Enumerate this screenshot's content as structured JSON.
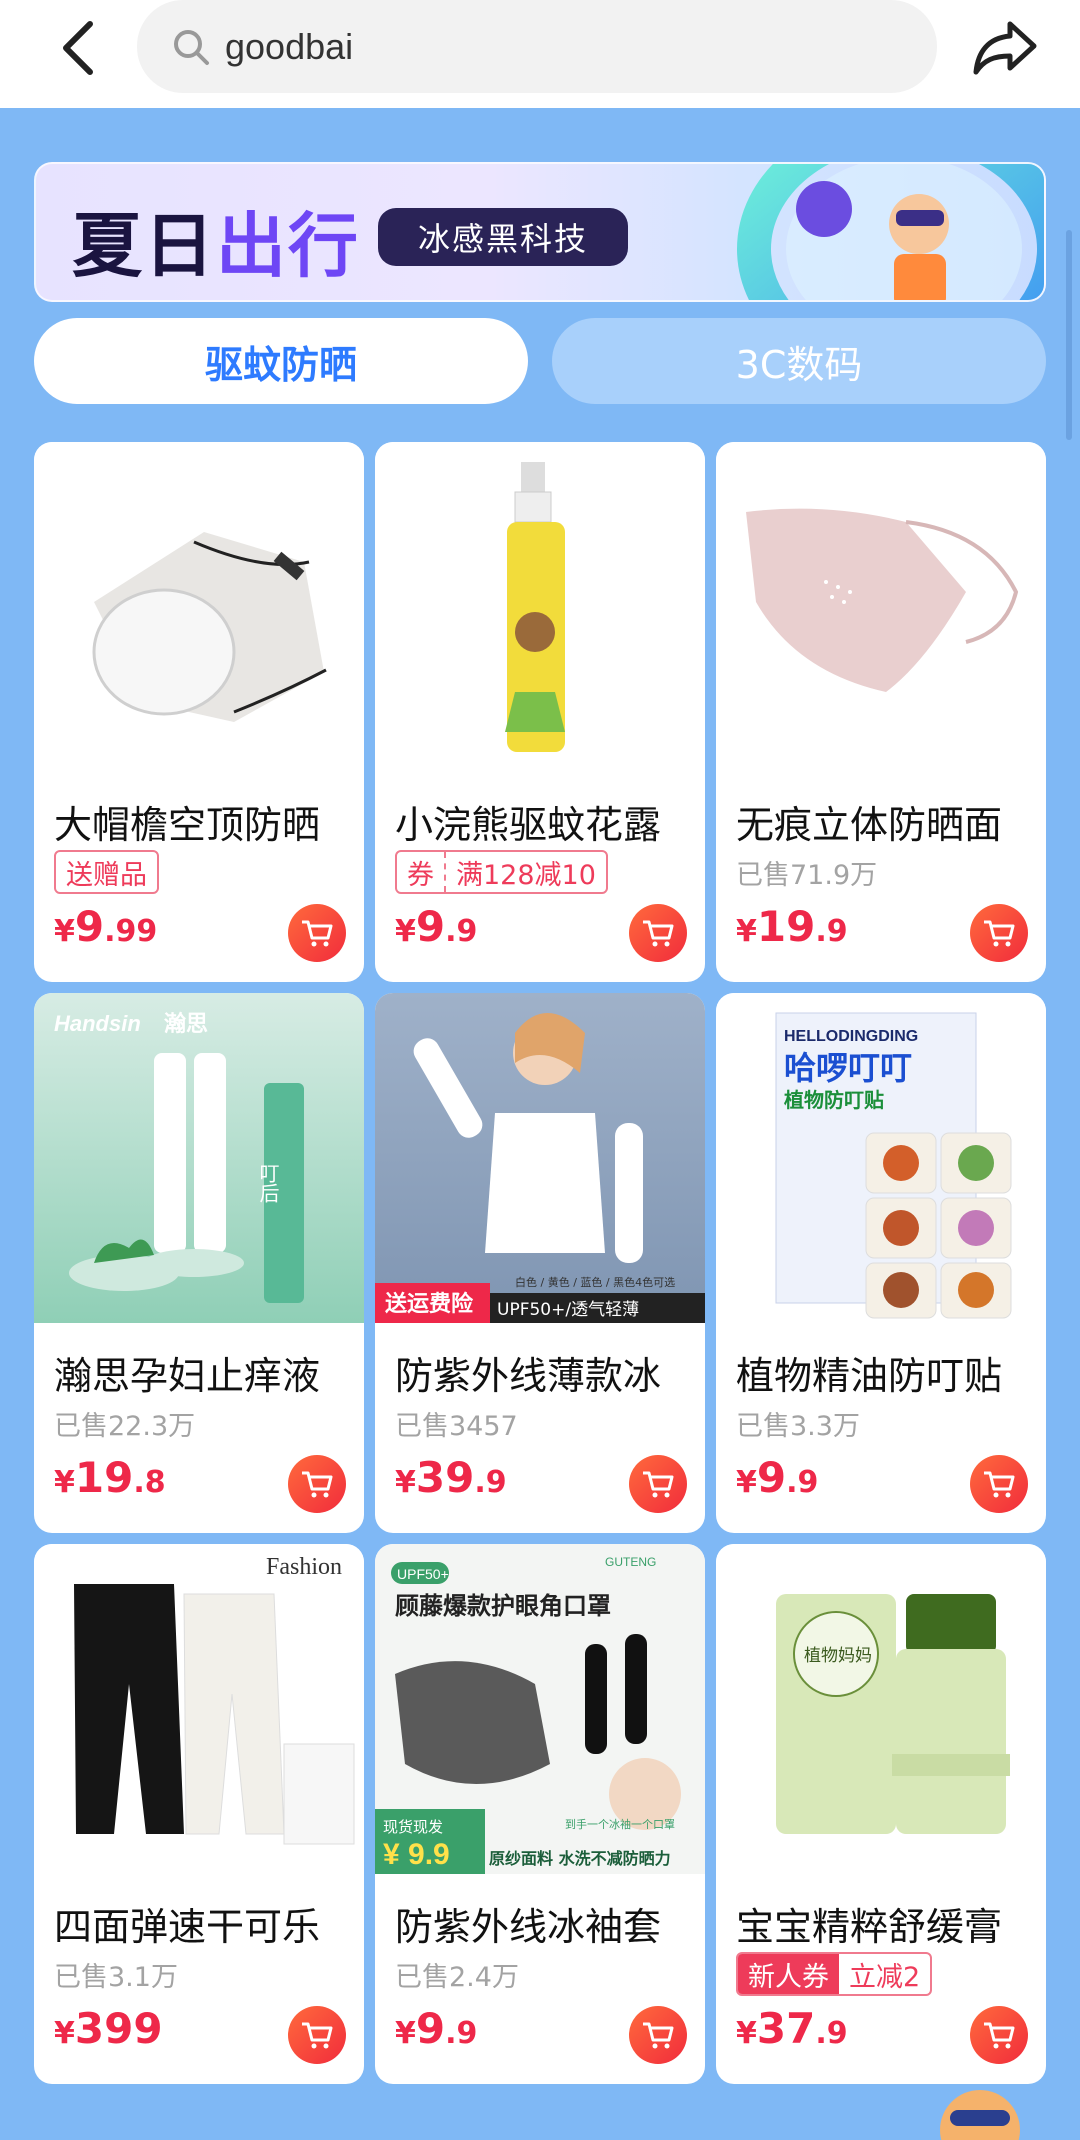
{
  "search": {
    "query": "goodbai"
  },
  "banner": {
    "title_a": "夏日",
    "title_b": "出行",
    "tag": "冰感黑科技"
  },
  "tabs": [
    {
      "label": "驱蚊防晒"
    },
    {
      "label": "3C数码"
    }
  ],
  "products": [
    {
      "title": "大帽檐空顶防晒",
      "badge": "送赠品",
      "sold": "",
      "coupon": null,
      "price_int": "9",
      "price_dec": ".99"
    },
    {
      "title": "小浣熊驱蚊花露",
      "badge": "",
      "sold": "",
      "coupon": {
        "left": "券",
        "right": "满128减10"
      },
      "price_int": "9",
      "price_dec": ".9"
    },
    {
      "title": "无痕立体防晒面",
      "badge": "",
      "sold": "已售71.9万",
      "coupon": null,
      "price_int": "19",
      "price_dec": ".9"
    },
    {
      "title": "瀚思孕妇止痒液",
      "badge": "",
      "sold": "已售22.3万",
      "coupon": null,
      "price_int": "19",
      "price_dec": ".8"
    },
    {
      "title": "防紫外线薄款冰",
      "badge": "",
      "sold": "已售3457",
      "coupon": null,
      "price_int": "39",
      "price_dec": ".9"
    },
    {
      "title": "植物精油防叮贴",
      "badge": "",
      "sold": "已售3.3万",
      "coupon": null,
      "price_int": "9",
      "price_dec": ".9"
    },
    {
      "title": "四面弹速干可乐",
      "badge": "",
      "sold": "已售3.1万",
      "coupon": null,
      "price_int": "399",
      "price_dec": ""
    },
    {
      "title": "防紫外线冰袖套",
      "badge": "",
      "sold": "已售2.4万",
      "coupon": null,
      "price_int": "9",
      "price_dec": ".9"
    },
    {
      "title": "宝宝精粹舒缓膏",
      "badge": "",
      "sold": "",
      "coupon": {
        "left": "新人券",
        "right": "立减2"
      },
      "price_int": "37",
      "price_dec": ".9"
    }
  ],
  "currency": "¥",
  "image_text": {
    "handsin_brand": "Handsin",
    "handsin_cn": "瀚思",
    "handsin_tube": "叮后",
    "sleeve_ribbon": "送运费险",
    "sleeve_band": "UPF50+/透气轻薄",
    "sleeve_colors": "白色 / 黄色 / 蓝色 / 黑色4色可选",
    "patch_brand": "HELLODINGDING",
    "patch_name": "哈啰叮叮",
    "patch_sub": "植物防叮贴",
    "fashion": "Fashion",
    "mask_upf": "UPF50+",
    "mask_title": "顾藤爆款护眼角口罩",
    "mask_brand": "GUTENG",
    "mask_note": "现货现发",
    "mask_price": "¥ 9.9",
    "mask_bottom": "原纱面料 水洗不减防晒力",
    "mask_arm": "到手一个冰袖一个口罩",
    "balm_label": "植物妈妈"
  }
}
